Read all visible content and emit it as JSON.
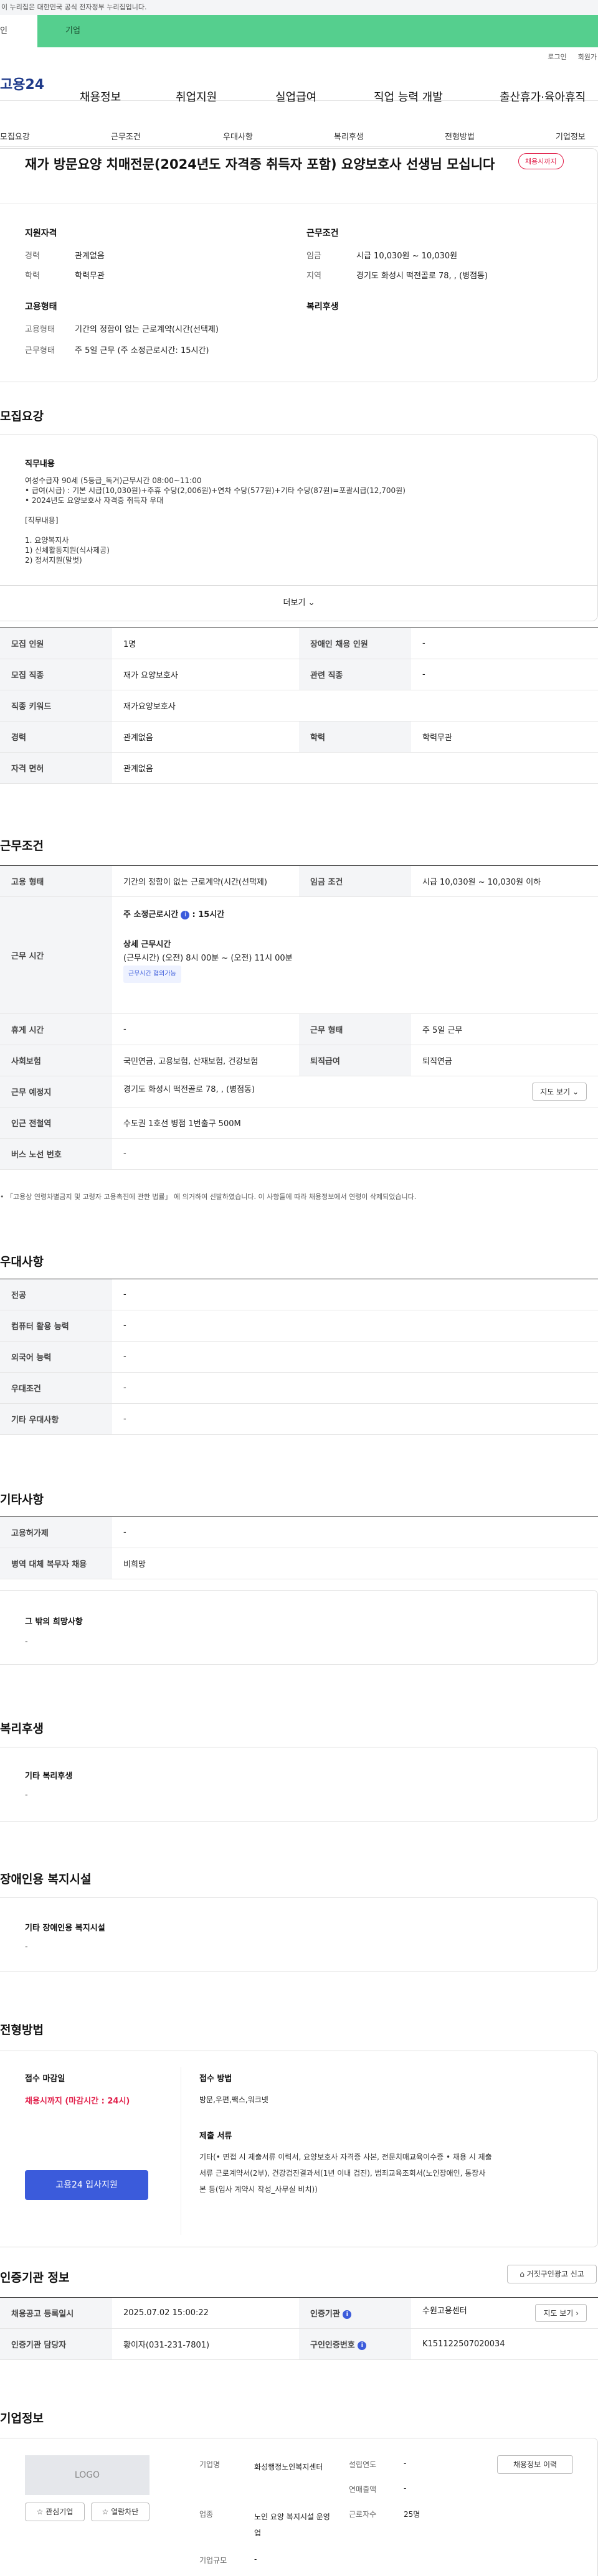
{
  "top_notice": "이 누리집은 대한민국 공식 전자정부 누리집입니다.",
  "user_tabs": {
    "individual": "인",
    "business": "기업"
  },
  "util": {
    "login": "로그인",
    "signup": "회원가"
  },
  "logo": "고용24",
  "gnb": [
    "채용정보",
    "취업지원",
    "실업급여",
    "직업 능력 개발",
    "출산휴가·육아휴직"
  ],
  "subtabs": [
    "모집요강",
    "근무조건",
    "우대사항",
    "복리후생",
    "전형방법",
    "기업정보"
  ],
  "job": {
    "title": "재가 방문요양 치매전문(2024년도 자격증 취득자 포함) 요양보호사 선생님 모십니다",
    "badge": "채용시까지",
    "qual_title": "지원자격",
    "qual": [
      {
        "label": "경력",
        "value": "관계없음"
      },
      {
        "label": "학력",
        "value": "학력무관"
      }
    ],
    "cond_title": "근무조건",
    "cond": [
      {
        "label": "임금",
        "value": "시급 10,030원 ~ 10,030원"
      },
      {
        "label": "지역",
        "value": "경기도 화성시 떡전골로 78, , (병점동)"
      }
    ],
    "emp_title": "고용형태",
    "emp": [
      {
        "label": "고용형태",
        "value": "기간의 정함이 없는 근로계약(시간(선택제)"
      },
      {
        "label": "근무형태",
        "value": "주 5일 근무 (주 소정근로시간: 15시간)"
      }
    ],
    "welfare_title": "복리후생"
  },
  "recruit": {
    "section_title": "모집요강",
    "duty_title": "직무내용",
    "duty_lines": [
      "여성수급자 90세 (5등급_독거)근무시간 08:00~11:00",
      "• 급여(시급) : 기본 시급(10,030원)+주휴 수당(2,006원)+연차 수당(577원)+기타 수당(87원)=포괄시급(12,700원)",
      "• 2024년도 요양보호사 자격증 취득자 우대",
      "",
      "[직무내용]",
      "",
      "1. 요양복지사",
      "1) 신체활동지원(식사제공)",
      "2) 정서지원(말벗)"
    ],
    "more": "더보기",
    "table": [
      [
        "모집 인원",
        "1명",
        "장애인 채용 인원",
        "-"
      ],
      [
        "모집 직종",
        "재가 요양보호사",
        "관련 직종",
        "-"
      ],
      [
        "직종 키워드",
        "재가요양보호사"
      ],
      [
        "경력",
        "관계없음",
        "학력",
        "학력무관"
      ],
      [
        "자격 면허",
        "관계없음"
      ]
    ]
  },
  "work": {
    "section_title": "근무조건",
    "emp_type_label": "고용 형태",
    "emp_type": "기간의 정함이 없는 근로계약(시간(선택제)",
    "wage_label": "임금 조건",
    "wage": "시급 10,030원 ~ 10,030원 이하",
    "hours_label": "근무 시간",
    "weekly_hours_title": "주 소정근로시간",
    "weekly_hours": ": 15시간",
    "detail_title": "상세 근무시간",
    "detail": "(근무시간) (오전) 8시 00분 ~ (오전) 11시 00분",
    "detail_tag": "근무시간 협의가능",
    "rest_label": "휴게 시간",
    "rest": "-",
    "form_label": "근무 형태",
    "form": "주 5일 근무",
    "insurance_label": "사회보험",
    "insurance": "국민연금, 고용보험, 산재보험, 건강보험",
    "retire_label": "퇴직급여",
    "retire": "퇴직연금",
    "place_label": "근무 예정지",
    "place": "경기도 화성시 떡전골로 78, , (병점동)",
    "map_btn": "지도 보기",
    "subway_label": "인근 전철역",
    "subway": "수도권 1호선 병점 1번출구 500M",
    "bus_label": "버스 노선 번호",
    "bus": "-",
    "note": "• 「고용상 연령차별금지 및 고령자 고용촉진에 관한 법률」 에 의거하여 선발하였습니다. 이 사항들에 따라 채용정보에서 연령이 삭제되었습니다."
  },
  "pref": {
    "section_title": "우대사항",
    "rows": [
      [
        "전공",
        "-"
      ],
      [
        "컴퓨터 활용 능력",
        "-"
      ],
      [
        "외국어 능력",
        "-"
      ],
      [
        "우대조건",
        "-"
      ],
      [
        "기타 우대사항",
        "-"
      ]
    ]
  },
  "etc": {
    "section_title": "기타사항",
    "rows": [
      [
        "고용허가제",
        "-"
      ],
      [
        "병역 대체 복무자 채용",
        "비희망"
      ]
    ],
    "other_title": "그 밖의 희망사항",
    "other": "-"
  },
  "welfare": {
    "section_title": "복리후생",
    "box_title": "기타 복리후생",
    "box_value": "-"
  },
  "disabled": {
    "section_title": "장애인용 복지시설",
    "box_title": "기타 장애인용 복지시설",
    "box_value": "-"
  },
  "selection": {
    "section_title": "전형방법",
    "deadline_title": "접수 마감일",
    "deadline": "채용시까지 (마감시간 : 24시)",
    "apply_btn": "고용24 입사지원",
    "method_title": "접수 방법",
    "method": "방문,우편,팩스,워크넷",
    "docs_title": "제출 서류",
    "docs_lines": [
      "기타(• 면접 시 제출서류    이력서, 요양보호사 자격증 사본, 전문치매교육이수증 • 채용 시 제출",
      "서류    근로계약서(2부), 건강검진결과서(1년 이내 검진), 범죄교육조회서(노인장애인, 통장사",
      "본 등(임사 계약시 작성_사무실 비치))"
    ]
  },
  "cert": {
    "section_title": "인증기관 정보",
    "report_btn": "거짓구인광고 신고",
    "rows": [
      [
        "채용공고 등록일시",
        "2025.07.02 15:00:22",
        "인증기관",
        "수원고용센터"
      ],
      [
        "인증기관 담당자",
        "황이자(031-231-7801)",
        "구인인증번호",
        "K151122507020034"
      ]
    ],
    "map_btn": "지도 보기"
  },
  "company": {
    "section_title": "기업정보",
    "logo_text": "LOGO",
    "fav_btn": "관심기업",
    "review_btn": "열람차단",
    "list_btn": "채용정보 이력",
    "rows": [
      {
        "label": "기업명",
        "value": "화성행정노인복지센터"
      },
      {
        "label": "업종",
        "value": "노인 요양 복지시설 운영업"
      },
      {
        "label": "기업규모",
        "value": "-"
      }
    ],
    "rows2": [
      {
        "label": "설립연도",
        "value": "-"
      },
      {
        "label": "연매출액",
        "value": "-"
      },
      {
        "label": "근로자수",
        "value": "25명"
      }
    ]
  },
  "colors": {
    "brand": "#1e3a8a",
    "biz_tab": "#55cf8e",
    "accent": "#3b5bdb",
    "alert": "#e11d48"
  }
}
